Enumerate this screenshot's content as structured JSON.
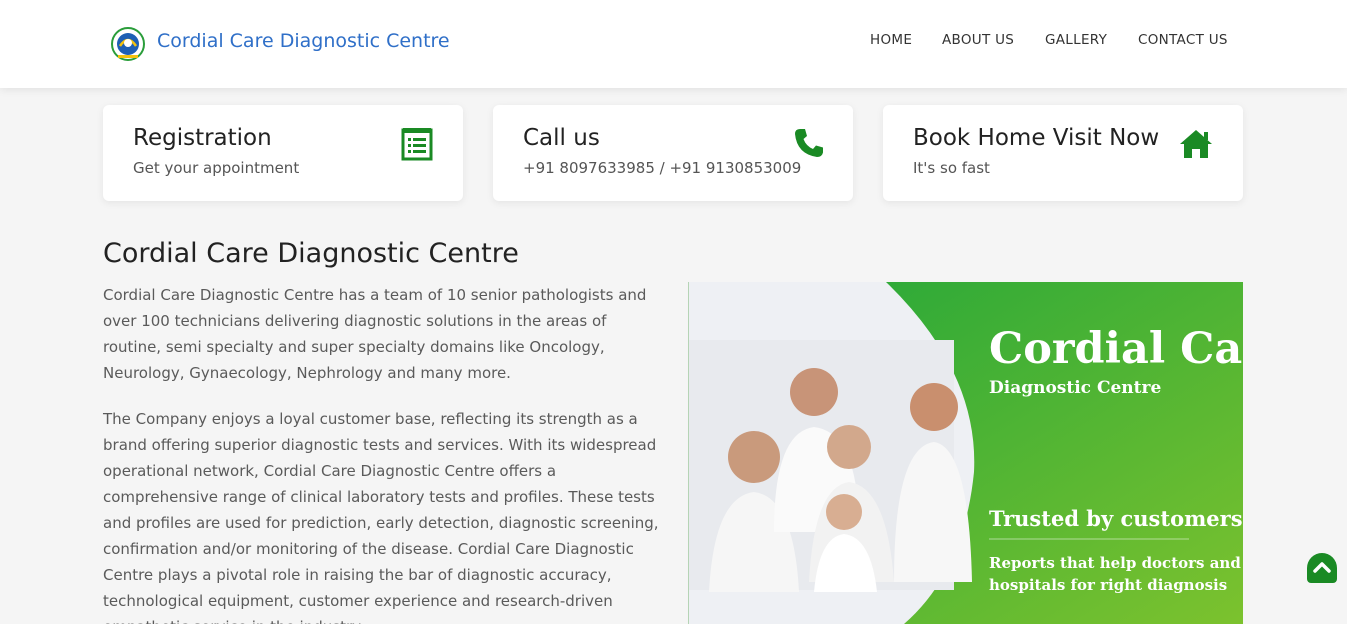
{
  "header": {
    "brand": "Cordial Care Diagnostic Centre",
    "logo_icon": "cordial-care-logo",
    "nav": [
      "HOME",
      "ABOUT US",
      "GALLERY",
      "CONTACT US"
    ]
  },
  "cards": [
    {
      "title": "Registration",
      "subtitle": "Get your appointment",
      "icon": "checklist-icon"
    },
    {
      "title": "Call us",
      "subtitle": "+91 8097633985 / +91 9130853009",
      "icon": "phone-icon"
    },
    {
      "title": "Book Home Visit Now",
      "subtitle": "It's so fast",
      "icon": "home-icon"
    }
  ],
  "about": {
    "heading": "Cordial Care Diagnostic Centre",
    "para1": "Cordial Care Diagnostic Centre has a team of 10 senior pathologists and over 100 technicians delivering diagnostic solutions in the areas of routine, semi specialty and super specialty domains like Oncology, Neurology, Gynaecology, Nephrology and many more.",
    "para2": "The Company enjoys a loyal customer base, reflecting its strength as a brand offering superior diagnostic tests and services. With its widespread operational network, Cordial Care Diagnostic Centre offers a comprehensive range of clinical laboratory tests and profiles. These tests and profiles are used for prediction, early detection, diagnostic screening, confirmation and/or monitoring of the disease. Cordial Care Diagnostic Centre plays a pivotal role in raising the bar of diagnostic accuracy, technological equipment, customer experience and research-driven empathetic service in the industry."
  },
  "banner": {
    "title": "Cordial Care",
    "subtitle": "Diagnostic Centre",
    "tagline": "Trusted by customers",
    "note_line1": "Reports that help doctors and",
    "note_line2": "hospitals for right diagnosis"
  },
  "colors": {
    "brand_blue": "#2f6fc8",
    "icon_green": "#1a8a24",
    "banner_green": "#3aad2a"
  },
  "scroll_top_icon": "chevron-up-icon"
}
